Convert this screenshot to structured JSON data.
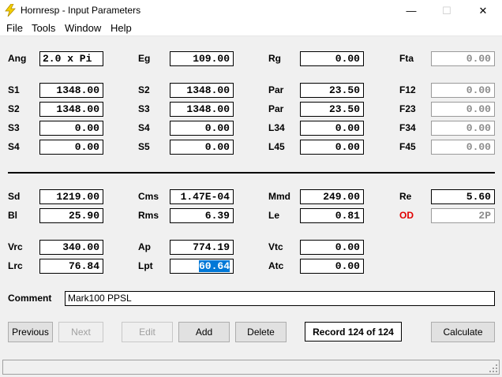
{
  "window": {
    "title": "Hornresp - Input Parameters",
    "icon": "lightning-icon",
    "minimize_glyph": "—",
    "maximize_glyph": "☐",
    "close_glyph": "✕"
  },
  "menu": [
    "File",
    "Tools",
    "Window",
    "Help"
  ],
  "top_params": {
    "col1": [
      {
        "label": "Ang",
        "value": "2.0 x Pi"
      },
      {
        "label": "S1",
        "value": "1348.00"
      },
      {
        "label": "S2",
        "value": "1348.00"
      },
      {
        "label": "S3",
        "value": "0.00"
      },
      {
        "label": "S4",
        "value": "0.00"
      }
    ],
    "col2": [
      {
        "label": "Eg",
        "value": "109.00"
      },
      {
        "label": "S2",
        "value": "1348.00"
      },
      {
        "label": "S3",
        "value": "1348.00"
      },
      {
        "label": "S4",
        "value": "0.00"
      },
      {
        "label": "S5",
        "value": "0.00"
      }
    ],
    "col3": [
      {
        "label": "Rg",
        "value": "0.00"
      },
      {
        "label": "Par",
        "value": "23.50"
      },
      {
        "label": "Par",
        "value": "23.50"
      },
      {
        "label": "L34",
        "value": "0.00"
      },
      {
        "label": "L45",
        "value": "0.00"
      }
    ],
    "col4": [
      {
        "label": "Fta",
        "value": "0.00"
      },
      {
        "label": "F12",
        "value": "0.00"
      },
      {
        "label": "F23",
        "value": "0.00"
      },
      {
        "label": "F34",
        "value": "0.00"
      },
      {
        "label": "F45",
        "value": "0.00"
      }
    ]
  },
  "driver_params": {
    "col1": [
      {
        "label": "Sd",
        "value": "1219.00"
      },
      {
        "label": "Bl",
        "value": "25.90"
      },
      {
        "label": "Vrc",
        "value": "340.00"
      },
      {
        "label": "Lrc",
        "value": "76.84"
      }
    ],
    "col2": [
      {
        "label": "Cms",
        "value": "1.47E-04"
      },
      {
        "label": "Rms",
        "value": "6.39"
      },
      {
        "label": "Ap",
        "value": "774.19"
      },
      {
        "label": "Lpt",
        "value": "60.64"
      }
    ],
    "col3": [
      {
        "label": "Mmd",
        "value": "249.00"
      },
      {
        "label": "Le",
        "value": "0.81"
      },
      {
        "label": "Vtc",
        "value": "0.00"
      },
      {
        "label": "Atc",
        "value": "0.00"
      }
    ],
    "col4": [
      {
        "label": "Re",
        "value": "5.60"
      },
      {
        "label": "OD",
        "value": "2P"
      }
    ]
  },
  "od_label_color": "#e00000",
  "selection_color": "#0078d7",
  "comment": {
    "label": "Comment",
    "value": "Mark100 PPSL"
  },
  "buttons": {
    "previous": "Previous",
    "next": "Next",
    "edit": "Edit",
    "add": "Add",
    "delete": "Delete",
    "calculate": "Calculate"
  },
  "record": "Record 124 of 124"
}
